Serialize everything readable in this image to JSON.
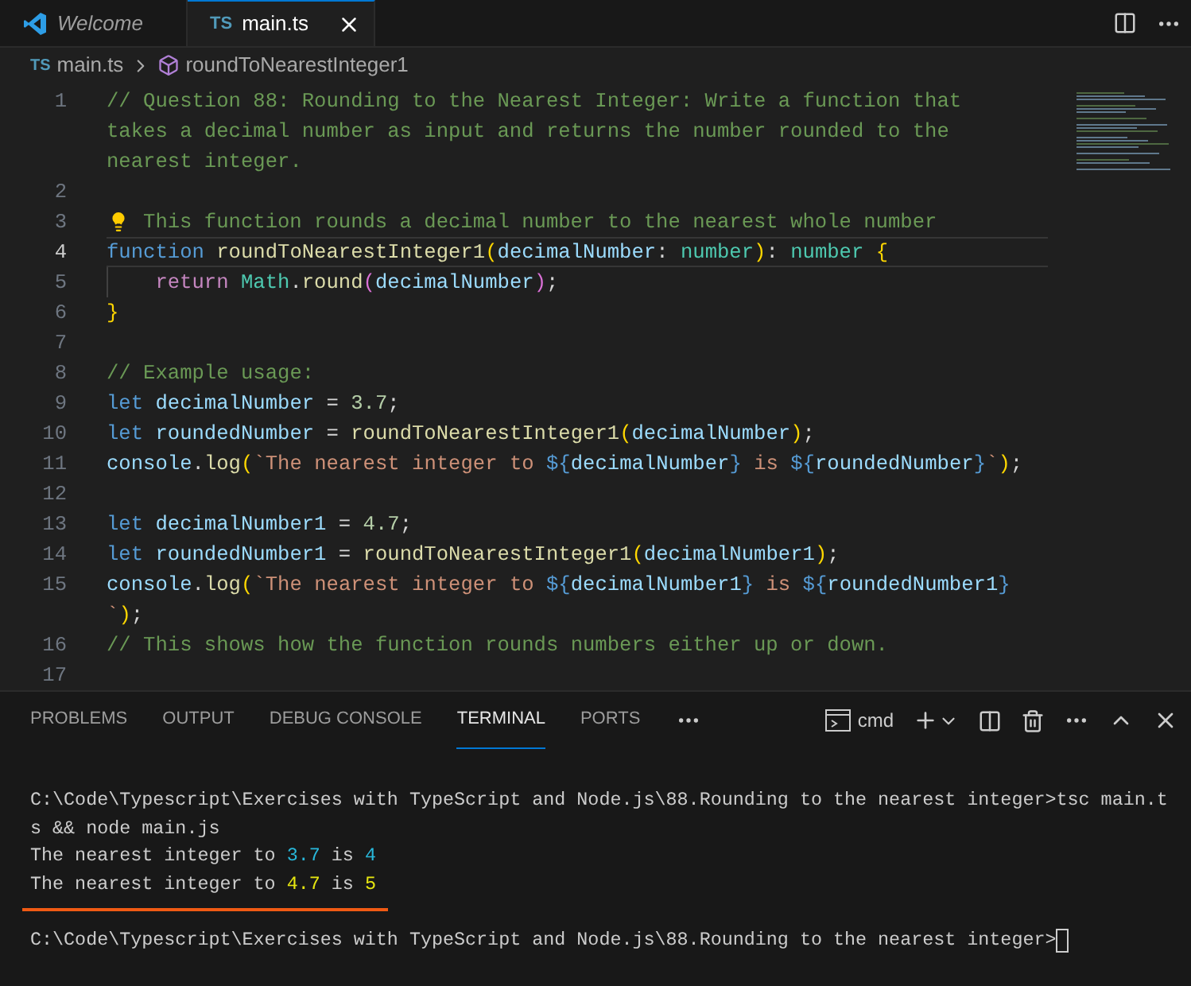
{
  "tabs": [
    {
      "label": "Welcome",
      "kind": "welcome",
      "selected": false
    },
    {
      "label": "main.ts",
      "kind": "ts",
      "badge": "TS",
      "selected": true
    }
  ],
  "breadcrumb": {
    "file_badge": "TS",
    "file": "main.ts",
    "symbol": "roundToNearestInteger1"
  },
  "editor": {
    "rows": [
      {
        "number": "1",
        "current": false,
        "tokens": [
          {
            "kind": "cmt",
            "text": "// Question 88: Rounding to the Nearest Integer: Write a function that"
          }
        ]
      },
      {
        "current": false,
        "tokens": [
          {
            "kind": "cmt",
            "text": "takes a decimal number as input and returns the number rounded to the"
          }
        ]
      },
      {
        "current": false,
        "tokens": [
          {
            "kind": "cmt",
            "text": "nearest integer."
          }
        ]
      },
      {
        "number": "2",
        "current": false
      },
      {
        "number": "3",
        "current": false,
        "tokens": [
          {
            "kind": "lightbulb"
          },
          {
            "kind": "cmt",
            "text": " This function rounds a decimal number to the nearest whole number"
          }
        ]
      },
      {
        "number": "4",
        "current": true,
        "tokens": [
          {
            "kind": "kw",
            "text": "function "
          },
          {
            "kind": "fn",
            "text": "roundToNearestInteger1"
          },
          {
            "kind": "brace",
            "text": "("
          },
          {
            "kind": "var",
            "text": "decimalNumber"
          },
          {
            "kind": "plain",
            "text": ": "
          },
          {
            "kind": "type",
            "text": "number"
          },
          {
            "kind": "brace",
            "text": ")"
          },
          {
            "kind": "plain",
            "text": ": "
          },
          {
            "kind": "type",
            "text": "number "
          },
          {
            "kind": "brace",
            "text": "{"
          }
        ]
      },
      {
        "number": "5",
        "current": false,
        "tokens": [
          {
            "kind": "indent"
          },
          {
            "kind": "ctrl",
            "text": "return "
          },
          {
            "kind": "type",
            "text": "Math"
          },
          {
            "kind": "plain",
            "text": "."
          },
          {
            "kind": "fn",
            "text": "round"
          },
          {
            "kind": "paren",
            "text": "("
          },
          {
            "kind": "var",
            "text": "decimalNumber"
          },
          {
            "kind": "paren",
            "text": ")"
          },
          {
            "kind": "plain",
            "text": ";"
          }
        ]
      },
      {
        "number": "6",
        "current": false,
        "tokens": [
          {
            "kind": "brace",
            "text": "}"
          }
        ]
      },
      {
        "number": "7",
        "current": false
      },
      {
        "number": "8",
        "current": false,
        "tokens": [
          {
            "kind": "cmt",
            "text": "// Example usage:"
          }
        ]
      },
      {
        "number": "9",
        "current": false,
        "tokens": [
          {
            "kind": "kw",
            "text": "let "
          },
          {
            "kind": "var",
            "text": "decimalNumber"
          },
          {
            "kind": "plain",
            "text": " = "
          },
          {
            "kind": "num",
            "text": "3.7"
          },
          {
            "kind": "plain",
            "text": ";"
          }
        ]
      },
      {
        "number": "10",
        "current": false,
        "tokens": [
          {
            "kind": "kw",
            "text": "let "
          },
          {
            "kind": "var",
            "text": "roundedNumber"
          },
          {
            "kind": "plain",
            "text": " = "
          },
          {
            "kind": "fn",
            "text": "roundToNearestInteger1"
          },
          {
            "kind": "brace",
            "text": "("
          },
          {
            "kind": "var",
            "text": "decimalNumber"
          },
          {
            "kind": "brace",
            "text": ")"
          },
          {
            "kind": "plain",
            "text": ";"
          }
        ]
      },
      {
        "number": "11",
        "current": false,
        "tokens": [
          {
            "kind": "var",
            "text": "console"
          },
          {
            "kind": "plain",
            "text": "."
          },
          {
            "kind": "fn",
            "text": "log"
          },
          {
            "kind": "brace",
            "text": "("
          },
          {
            "kind": "str",
            "text": "`The nearest integer to "
          },
          {
            "kind": "tpl",
            "text": "${"
          },
          {
            "kind": "var",
            "text": "decimalNumber"
          },
          {
            "kind": "tpl",
            "text": "}"
          },
          {
            "kind": "str",
            "text": " is "
          },
          {
            "kind": "tpl",
            "text": "${"
          },
          {
            "kind": "var",
            "text": "roundedNumber"
          },
          {
            "kind": "tpl",
            "text": "}"
          },
          {
            "kind": "str",
            "text": "`"
          },
          {
            "kind": "brace",
            "text": ")"
          },
          {
            "kind": "plain",
            "text": ";"
          }
        ]
      },
      {
        "number": "12",
        "current": false
      },
      {
        "number": "13",
        "current": false,
        "tokens": [
          {
            "kind": "kw",
            "text": "let "
          },
          {
            "kind": "var",
            "text": "decimalNumber1"
          },
          {
            "kind": "plain",
            "text": " = "
          },
          {
            "kind": "num",
            "text": "4.7"
          },
          {
            "kind": "plain",
            "text": ";"
          }
        ]
      },
      {
        "number": "14",
        "current": false,
        "tokens": [
          {
            "kind": "kw",
            "text": "let "
          },
          {
            "kind": "var",
            "text": "roundedNumber1"
          },
          {
            "kind": "plain",
            "text": " = "
          },
          {
            "kind": "fn",
            "text": "roundToNearestInteger1"
          },
          {
            "kind": "brace",
            "text": "("
          },
          {
            "kind": "var",
            "text": "decimalNumber1"
          },
          {
            "kind": "brace",
            "text": ")"
          },
          {
            "kind": "plain",
            "text": ";"
          }
        ]
      },
      {
        "number": "15",
        "current": false,
        "tokens": [
          {
            "kind": "var",
            "text": "console"
          },
          {
            "kind": "plain",
            "text": "."
          },
          {
            "kind": "fn",
            "text": "log"
          },
          {
            "kind": "brace",
            "text": "("
          },
          {
            "kind": "str",
            "text": "`The nearest integer to "
          },
          {
            "kind": "tpl",
            "text": "${"
          },
          {
            "kind": "var",
            "text": "decimalNumber1"
          },
          {
            "kind": "tpl",
            "text": "}"
          },
          {
            "kind": "str",
            "text": " is "
          },
          {
            "kind": "tpl",
            "text": "${"
          },
          {
            "kind": "var",
            "text": "roundedNumber1"
          },
          {
            "kind": "tpl",
            "text": "}"
          }
        ]
      },
      {
        "current": false,
        "tokens": [
          {
            "kind": "str",
            "text": "`"
          },
          {
            "kind": "brace",
            "text": ")"
          },
          {
            "kind": "plain",
            "text": ";"
          }
        ]
      },
      {
        "number": "16",
        "current": false,
        "tokens": [
          {
            "kind": "cmt",
            "text": "// This shows how the function rounds numbers either up or down."
          }
        ]
      },
      {
        "number": "17",
        "current": false
      }
    ]
  },
  "panel": {
    "tabs": [
      {
        "label": "PROBLEMS",
        "selected": false
      },
      {
        "label": "OUTPUT",
        "selected": false
      },
      {
        "label": "DEBUG CONSOLE",
        "selected": false
      },
      {
        "label": "TERMINAL",
        "selected": true
      },
      {
        "label": "PORTS",
        "selected": false
      }
    ],
    "shell": "cmd"
  },
  "terminal": {
    "lines": [
      {
        "kind": "blank"
      },
      {
        "tokens": [
          {
            "kind": "text",
            "text": "C:\\Code\\Typescript\\Exercises with TypeScript and Node.js\\88.Rounding to the nearest integer>tsc main.t"
          }
        ]
      },
      {
        "tokens": [
          {
            "kind": "text",
            "text": "s && node main.js"
          }
        ]
      },
      {
        "tokens": [
          {
            "kind": "text",
            "text": "The nearest integer to "
          },
          {
            "kind": "info",
            "text": "3.7"
          },
          {
            "kind": "text",
            "text": " is "
          },
          {
            "kind": "info",
            "text": "4"
          }
        ]
      },
      {
        "tokens": [
          {
            "kind": "text",
            "text": "The nearest integer to "
          },
          {
            "kind": "warning",
            "text": "4.7"
          },
          {
            "kind": "text",
            "text": " is "
          },
          {
            "kind": "warning",
            "text": "5"
          }
        ]
      },
      {
        "kind": "underline"
      },
      {
        "tokens": [
          {
            "kind": "text",
            "text": "C:\\Code\\Typescript\\Exercises with TypeScript and Node.js\\88.Rounding to the nearest integer>"
          },
          {
            "kind": "cursor"
          }
        ]
      }
    ]
  }
}
